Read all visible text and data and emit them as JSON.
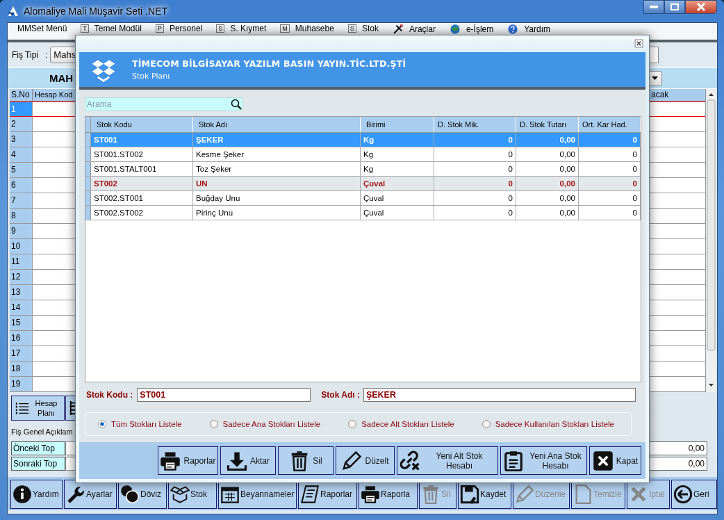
{
  "window": {
    "title": "Alomaliye Mali Müşavir Seti .NET"
  },
  "menu": [
    {
      "kind": "plain",
      "label": "MMSet Menü"
    },
    {
      "kind": "key",
      "key": "T",
      "label": "Temel Modül"
    },
    {
      "kind": "key",
      "key": "P",
      "label": "Personel"
    },
    {
      "kind": "key",
      "key": "S",
      "label": "S. Kıymet"
    },
    {
      "kind": "key",
      "key": "M",
      "label": "Muhasebe"
    },
    {
      "kind": "key",
      "key": "S",
      "label": "Stok"
    },
    {
      "kind": "tools",
      "label": "Araçlar"
    },
    {
      "kind": "globe",
      "label": "e-İşlem"
    },
    {
      "kind": "help",
      "label": "Yardım"
    }
  ],
  "fis_tipi": {
    "label": "Fiş Tipi",
    "separator": ":",
    "value": "Mahs"
  },
  "heading": "MAH",
  "grid": {
    "columns": [
      "S.No",
      "Hesap Kod",
      "acak"
    ],
    "rows": [
      {
        "no": "1",
        "selected": true
      },
      {
        "no": "2",
        "selected": false
      },
      {
        "no": "3",
        "selected": false
      },
      {
        "no": "4",
        "selected": false
      },
      {
        "no": "5",
        "selected": false
      },
      {
        "no": "6",
        "selected": false
      },
      {
        "no": "7",
        "selected": false
      },
      {
        "no": "8",
        "selected": false
      },
      {
        "no": "9",
        "selected": false
      },
      {
        "no": "10",
        "selected": false
      },
      {
        "no": "11",
        "selected": false
      },
      {
        "no": "12",
        "selected": false
      },
      {
        "no": "13",
        "selected": false
      },
      {
        "no": "14",
        "selected": false
      },
      {
        "no": "15",
        "selected": false
      },
      {
        "no": "16",
        "selected": false
      },
      {
        "no": "17",
        "selected": false
      },
      {
        "no": "18",
        "selected": false
      },
      {
        "no": "19",
        "selected": false
      }
    ]
  },
  "side_button": "Hesap Planı",
  "description_label": "Fiş Genel Açıklam",
  "totals": [
    {
      "label": "Önceki Top",
      "value": "0,00"
    },
    {
      "label": "Sonraki Top",
      "value": "0,00"
    }
  ],
  "toolbar": [
    {
      "label": "Yardım",
      "disabled": false
    },
    {
      "label": "Ayarlar",
      "disabled": false
    },
    {
      "label": "Döviz",
      "disabled": false
    },
    {
      "label": "Stok",
      "disabled": false
    },
    {
      "label": "Beyannameler",
      "disabled": false
    },
    {
      "label": "Raporlar",
      "disabled": false
    },
    {
      "label": "Raporla",
      "disabled": false
    },
    {
      "label": "Sil",
      "disabled": true
    },
    {
      "label": "Kaydet",
      "disabled": false
    },
    {
      "label": "Düzenle",
      "disabled": true
    },
    {
      "label": "Temizle",
      "disabled": true
    },
    {
      "label": "İptal",
      "disabled": true
    },
    {
      "label": "Geri",
      "disabled": false
    }
  ],
  "dialog": {
    "company": "TİMECOM BİLGİSAYAR YAZILM BASIN YAYIN.TİC.LTD.ŞTİ",
    "subtitle": "Stok Planı",
    "search": {
      "placeholder": "Arama"
    },
    "table": {
      "columns": [
        "Stok Kodu",
        "Stok Adı",
        "Birimi",
        "D. Stok Mik.",
        "D. Stok Tutarı",
        "Ort. Kar Had."
      ],
      "rows": [
        {
          "kind": "main",
          "selected": true,
          "cells": [
            "ST001",
            "ŞEKER",
            "Kg",
            "0",
            "0,00",
            "0"
          ]
        },
        {
          "kind": "sub",
          "selected": false,
          "cells": [
            "ST001.ST002",
            "Kesme Şeker",
            "Kg",
            "0",
            "0,00",
            "0"
          ]
        },
        {
          "kind": "sub",
          "selected": false,
          "cells": [
            "ST001.STALT001",
            "Toz Şeker",
            "Kg",
            "0",
            "0,00",
            "0"
          ]
        },
        {
          "kind": "main",
          "selected": false,
          "cells": [
            "ST002",
            "UN",
            "Çuval",
            "0",
            "0,00",
            "0"
          ]
        },
        {
          "kind": "sub",
          "selected": false,
          "cells": [
            "ST002.ST001",
            "Buğday Unu",
            "Çuval",
            "0",
            "0,00",
            "0"
          ]
        },
        {
          "kind": "sub",
          "selected": false,
          "cells": [
            "ST002.ST002",
            "Pirinç Unu",
            "Çuval",
            "0",
            "0,00",
            "0"
          ]
        }
      ]
    },
    "fields": [
      {
        "label": "Stok Kodu :",
        "value": "ST001"
      },
      {
        "label": "Stok Adı :",
        "value": "ŞEKER"
      }
    ],
    "filters": [
      {
        "label": "Tüm Stokları Listele",
        "selected": true
      },
      {
        "label": "Sadece Ana Stokları Listele",
        "selected": false
      },
      {
        "label": "Sadece Alt Stokları Listele",
        "selected": false
      },
      {
        "label": "Sadece Kullanılan Stokları Listele",
        "selected": false
      }
    ],
    "buttons": [
      {
        "label": "Raporlar"
      },
      {
        "label": "Aktar"
      },
      {
        "label": "Sil"
      },
      {
        "label": "Düzelt"
      },
      {
        "label": "Yeni Alt Stok Hesabı"
      },
      {
        "label": "Yeni Ana Stok Hesabı"
      },
      {
        "label": "Kapat"
      }
    ]
  }
}
